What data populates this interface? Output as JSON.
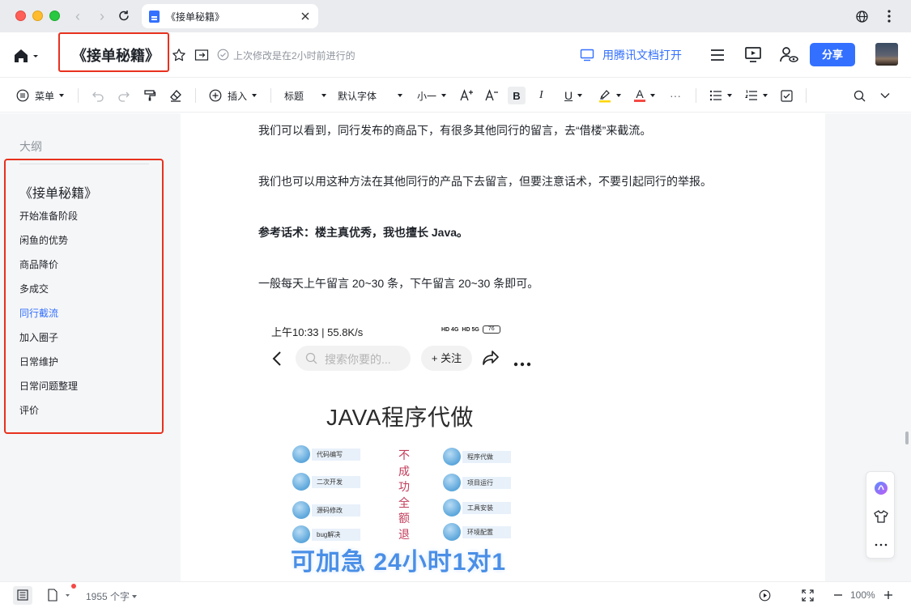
{
  "browser": {
    "tab_title": "《接单秘籍》"
  },
  "header": {
    "doc_title": "《接单秘籍》",
    "last_saved": "上次修改是在2小时前进行的",
    "open_in_tencent_docs": "用腾讯文档打开",
    "share_button": "分享"
  },
  "toolbar": {
    "menu": "菜单",
    "insert": "插入",
    "heading_style": "标题",
    "font_family": "默认字体",
    "font_size": "小一",
    "bold": "B",
    "italic": "I",
    "underline": "U",
    "font_color": "A",
    "more": "···"
  },
  "outline": {
    "label": "大纲",
    "heading": "《接单秘籍》",
    "items": [
      {
        "label": "开始准备阶段",
        "active": false
      },
      {
        "label": "闲鱼的优势",
        "active": false
      },
      {
        "label": "商品降价",
        "active": false
      },
      {
        "label": "多成交",
        "active": false
      },
      {
        "label": "同行截流",
        "active": true
      },
      {
        "label": "加入圈子",
        "active": false
      },
      {
        "label": "日常维护",
        "active": false
      },
      {
        "label": "日常问题整理",
        "active": false
      },
      {
        "label": "评价",
        "active": false
      }
    ]
  },
  "document": {
    "paragraphs": [
      {
        "text": "我们可以看到，同行发布的商品下，有很多其他同行的留言，去“借楼”来截流。",
        "bold": false
      },
      {
        "text": "我们也可以用这种方法在其他同行的产品下去留言，但要注意话术，不要引起同行的举报。",
        "bold": false
      },
      {
        "text": "参考话术：楼主真优秀，我也擅长 Java。",
        "bold": true
      },
      {
        "text": "一般每天上午留言 20~30 条，下午留言 20~30 条即可。",
        "bold": false
      }
    ],
    "embedded_screenshot": {
      "status_time": "上午10:33 | 55.8K/s",
      "network_1": "HD 4G",
      "network_2": "HD 5G",
      "battery": "76",
      "search_placeholder": "搜索你要的...",
      "follow": "+ 关注",
      "poster_title": "JAVA程序代做",
      "tags_left": [
        "代码编写",
        "二次开发",
        "源码修改",
        "bug解决"
      ],
      "tags_right": [
        "程序代做",
        "项目运行",
        "工具安装",
        "环境配置"
      ],
      "vertical_text": [
        "不",
        "成",
        "功",
        "全",
        "额",
        "退"
      ],
      "promo": "可加急  24小时1对1"
    }
  },
  "footer": {
    "word_count": "1955 个字",
    "zoom": "100%"
  },
  "colors": {
    "accent": "#3370ff",
    "highlight_border": "#e8311e",
    "font_color_underline": "#f54a45",
    "highlighter": "#ffd500"
  }
}
